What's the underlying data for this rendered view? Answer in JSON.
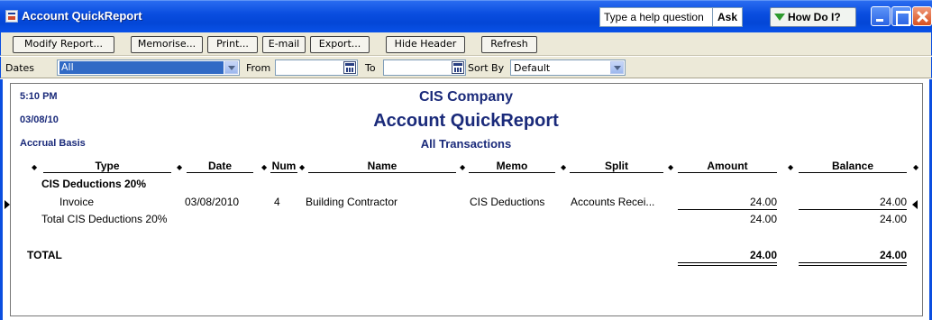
{
  "window": {
    "title": "Account QuickReport",
    "help_placeholder": "Type a help question",
    "ask_label": "Ask",
    "howdoi_label": "How Do I?"
  },
  "toolbar": {
    "modify_report": "Modify Report...",
    "memorise": "Memorise...",
    "print": "Print...",
    "email": "E-mail",
    "export": "Export...",
    "hide_header": "Hide Header",
    "refresh": "Refresh"
  },
  "filters": {
    "dates_label": "Dates",
    "dates_value": "All",
    "from_label": "From",
    "from_value": "",
    "to_label": "To",
    "to_value": "",
    "sort_by_label": "Sort By",
    "sort_by_value": "Default"
  },
  "report": {
    "time": "5:10 PM",
    "date": "03/08/10",
    "basis": "Accrual Basis",
    "company": "CIS Company",
    "title": "Account QuickReport",
    "subtitle": "All Transactions",
    "columns": [
      "Type",
      "Date",
      "Num",
      "Name",
      "Memo",
      "Split",
      "Amount",
      "Balance"
    ],
    "group_label": "CIS Deductions 20%",
    "rows": [
      {
        "type": "Invoice",
        "date": "03/08/2010",
        "num": "4",
        "name": "Building Contractor",
        "memo": "CIS Deductions",
        "split": "Accounts Recei...",
        "amount": "24.00",
        "balance": "24.00"
      }
    ],
    "group_total_label": "Total CIS Deductions 20%",
    "group_total_amount": "24.00",
    "group_total_balance": "24.00",
    "grand_total_label": "TOTAL",
    "grand_total_amount": "24.00",
    "grand_total_balance": "24.00"
  }
}
